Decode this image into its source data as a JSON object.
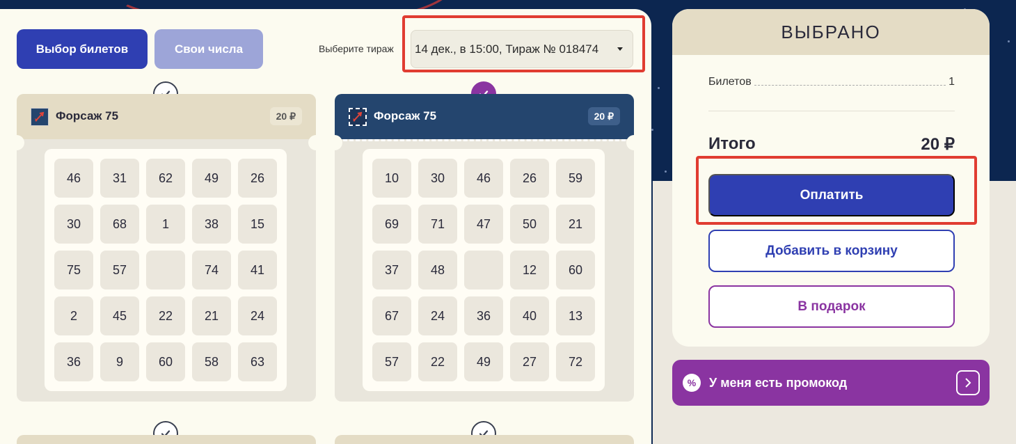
{
  "colors": {
    "primary": "#2f3fb2",
    "primary_muted": "#9da5d8",
    "accent_purple": "#8a34a1",
    "ticket_selected_header": "#24456e",
    "ticket_header": "#e4dcc5",
    "highlight": "#e03c31"
  },
  "mode_tabs": {
    "active": "Выбор билетов",
    "inactive": "Свои числа"
  },
  "draw": {
    "label": "Выберите тираж",
    "selected": "14 дек., в 15:00, Тираж № 018474"
  },
  "tickets": [
    {
      "name": "Форсаж 75",
      "price": "20 ₽",
      "selected": false,
      "icon": "rocket-icon",
      "numbers": [
        "46",
        "31",
        "62",
        "49",
        "26",
        "30",
        "68",
        "1",
        "38",
        "15",
        "75",
        "57",
        "",
        "74",
        "41",
        "2",
        "45",
        "22",
        "21",
        "24",
        "36",
        "9",
        "60",
        "58",
        "63"
      ]
    },
    {
      "name": "Форсаж 75",
      "price": "20 ₽",
      "selected": true,
      "icon": "rocket-icon",
      "numbers": [
        "10",
        "30",
        "46",
        "26",
        "59",
        "69",
        "71",
        "47",
        "50",
        "21",
        "37",
        "48",
        "",
        "12",
        "60",
        "67",
        "24",
        "36",
        "40",
        "13",
        "57",
        "22",
        "49",
        "27",
        "72"
      ]
    }
  ],
  "summary": {
    "title": "ВЫБРАНО",
    "tickets_label": "Билетов",
    "tickets_count": "1",
    "total_label": "Итого",
    "total_value": "20 ₽",
    "pay_label": "Оплатить",
    "cart_label": "Добавить в корзину",
    "gift_label": "В подарок"
  },
  "promo": {
    "icon": "%",
    "label": "У меня есть промокод"
  }
}
